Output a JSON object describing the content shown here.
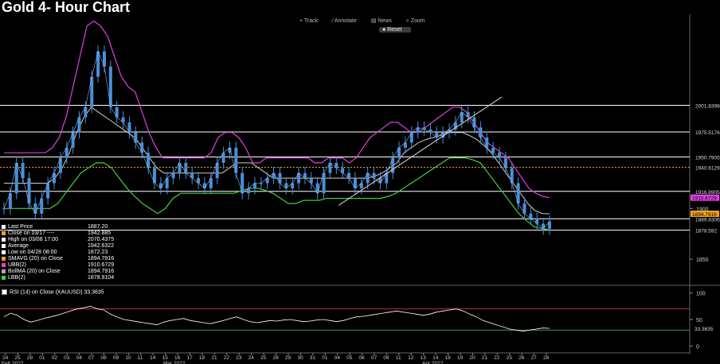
{
  "title": "Gold 4- Hour Chart",
  "toolbar": {
    "track": "Track",
    "annotate": "Annotate",
    "news": "News",
    "zoom": "Zoom",
    "reset": "Reset"
  },
  "legend": [
    {
      "label": "Last Price",
      "value": "1887.20",
      "color": "#ffffff"
    },
    {
      "label": "Close on 03/17 ----",
      "value": "1942.885",
      "color": "#f0a020"
    },
    {
      "label": "High on 03/08 17:00",
      "value": "2070.4375",
      "color": "#ffffff"
    },
    {
      "label": "Average",
      "value": "1942.6322",
      "color": "#ffffff"
    },
    {
      "label": "Low on 04/28 08:00",
      "value": "1872.23",
      "color": "#ffffff"
    },
    {
      "label": "SMAVG (20)  on Close",
      "value": "1894.7916",
      "color": "#f0a020"
    },
    {
      "label": "UBB(2)",
      "value": "1910.6729",
      "color": "#e040e0"
    },
    {
      "label": "BollMA (20)  on Close",
      "value": "1894.7916",
      "color": "#aaaaaa"
    },
    {
      "label": "LBB(2)",
      "value": "1878.9104",
      "color": "#40d040"
    }
  ],
  "rsi_label": "RSI (14)  on Close (XAUUSD) 33.3635",
  "colors": {
    "upper_band": "#e040e0",
    "lower_band": "#40d040",
    "mid_band": "#cccccc",
    "price": "#4a8fd8",
    "rsi": "#ffffff",
    "rsi_overbought": "#c03030"
  },
  "chart_data": [
    {
      "type": "line",
      "title": "Gold 4- Hour Chart",
      "xlabel": "",
      "ylabel": "",
      "x_ticks": [
        "24",
        "25",
        "28",
        "01",
        "02",
        "03",
        "04",
        "07",
        "08",
        "09",
        "10",
        "11",
        "14",
        "15",
        "16",
        "17",
        "18",
        "21",
        "22",
        "23",
        "24",
        "25",
        "28",
        "29",
        "30",
        "31",
        "01",
        "04",
        "05",
        "06",
        "07",
        "08",
        "11",
        "12",
        "13",
        "14",
        "18",
        "19",
        "20",
        "21",
        "22",
        "25",
        "26",
        "27",
        "28"
      ],
      "months": [
        "Feb 2022",
        "Mar 2022",
        "Apr 2022"
      ],
      "y_ticks": [
        1850,
        1900
      ],
      "ylim": [
        1825,
        2090
      ],
      "horizontal_levels": [
        {
          "label": "2001.8398",
          "value": 2001.8398
        },
        {
          "label": "1975.5176",
          "value": 1975.5176
        },
        {
          "label": "1950.7905",
          "value": 1950.7905
        },
        {
          "label": "1940.6129",
          "value": 1940.6129
        },
        {
          "label": "1916.8905",
          "value": 1916.8905
        },
        {
          "label": "1889.8306",
          "value": 1889.8306
        },
        {
          "label": "1878.592",
          "value": 1878.592
        }
      ],
      "right_labels": [
        {
          "label": "1910.6729",
          "value": 1910.6729,
          "color": "#e040e0"
        },
        {
          "label": "1894.7916",
          "value": 1894.7916,
          "color": "#f0a020"
        }
      ],
      "series": [
        {
          "name": "Last Price",
          "values": [
            1900,
            1915,
            1945,
            1930,
            1905,
            1895,
            1910,
            1925,
            1935,
            1950,
            1960,
            1975,
            1990,
            2000,
            2030,
            2055,
            2040,
            2000,
            1990,
            1985,
            1975,
            1965,
            1955,
            1940,
            1925,
            1920,
            1930,
            1935,
            1945,
            1935,
            1930,
            1925,
            1920,
            1930,
            1945,
            1955,
            1960,
            1935,
            1915,
            1920,
            1925,
            1925,
            1930,
            1935,
            1925,
            1920,
            1925,
            1935,
            1930,
            1925,
            1915,
            1935,
            1945,
            1940,
            1935,
            1930,
            1920,
            1925,
            1935,
            1930,
            1925,
            1935,
            1950,
            1960,
            1965,
            1975,
            1980,
            1978,
            1975,
            1970,
            1975,
            1978,
            1985,
            1995,
            1990,
            1980,
            1970,
            1960,
            1955,
            1950,
            1940,
            1925,
            1905,
            1895,
            1890,
            1885,
            1880,
            1887.2
          ]
        },
        {
          "name": "UBB(2)",
          "values": [
            1955,
            1955,
            1955,
            1955,
            1955,
            1955,
            1955,
            1960,
            1970,
            1990,
            2020,
            2050,
            2080,
            2085,
            2080,
            2070,
            2050,
            2030,
            2020,
            2015,
            1995,
            1975,
            1960,
            1950,
            1950,
            1950,
            1950,
            1950,
            1950,
            1950,
            1955,
            1970,
            1975,
            1975,
            1970,
            1960,
            1945,
            1945,
            1950,
            1950,
            1950,
            1950,
            1950,
            1950,
            1950,
            1945,
            1945,
            1950,
            1950,
            1950,
            1945,
            1950,
            1960,
            1970,
            1975,
            1980,
            1985,
            1985,
            1980,
            1975,
            1975,
            1980,
            1985,
            1990,
            1995,
            2000,
            2000,
            1995,
            1985,
            1975,
            1965,
            1960,
            1955,
            1950,
            1940,
            1930,
            1920,
            1915,
            1912,
            1910.67
          ]
        },
        {
          "name": "BollMA (20)",
          "values": [
            1925,
            1925,
            1925,
            1925,
            1925,
            1925,
            1925,
            1930,
            1940,
            1955,
            1975,
            1990,
            2000,
            1995,
            1990,
            1985,
            1980,
            1975,
            1970,
            1960,
            1950,
            1940,
            1935,
            1935,
            1935,
            1935,
            1935,
            1935,
            1935,
            1935,
            1935,
            1940,
            1945,
            1945,
            1945,
            1940,
            1935,
            1930,
            1930,
            1930,
            1930,
            1930,
            1930,
            1930,
            1930,
            1930,
            1930,
            1930,
            1930,
            1930,
            1930,
            1932,
            1935,
            1940,
            1945,
            1955,
            1960,
            1965,
            1968,
            1970,
            1972,
            1975,
            1975,
            1975,
            1972,
            1968,
            1962,
            1955,
            1945,
            1935,
            1925,
            1915,
            1905,
            1898,
            1895,
            1894.79
          ]
        },
        {
          "name": "LBB(2)",
          "values": [
            1900,
            1900,
            1900,
            1900,
            1900,
            1900,
            1900,
            1905,
            1915,
            1925,
            1935,
            1940,
            1945,
            1945,
            1940,
            1930,
            1920,
            1912,
            1905,
            1900,
            1895,
            1900,
            1910,
            1915,
            1915,
            1915,
            1915,
            1915,
            1915,
            1915,
            1915,
            1918,
            1920,
            1920,
            1918,
            1915,
            1910,
            1905,
            1905,
            1908,
            1908,
            1908,
            1910,
            1910,
            1910,
            1910,
            1910,
            1910,
            1910,
            1910,
            1912,
            1915,
            1920,
            1925,
            1930,
            1935,
            1940,
            1945,
            1950,
            1950,
            1950,
            1948,
            1945,
            1935,
            1925,
            1915,
            1905,
            1895,
            1888,
            1882,
            1880,
            1878.91
          ]
        }
      ]
    },
    {
      "type": "line",
      "title": "RSI (14)  on Close (XAUUSD) 33.3635",
      "y_ticks": [
        0,
        50,
        100
      ],
      "ylim": [
        -10,
        110
      ],
      "levels": [
        70,
        30
      ],
      "right_labels": [
        {
          "label": "33.3635",
          "value": 33.3635
        }
      ],
      "series": [
        {
          "name": "RSI (14)",
          "values": [
            55,
            62,
            58,
            50,
            45,
            48,
            52,
            55,
            58,
            62,
            66,
            70,
            72,
            75,
            70,
            68,
            60,
            55,
            50,
            48,
            46,
            44,
            42,
            40,
            45,
            48,
            50,
            52,
            48,
            46,
            44,
            42,
            45,
            48,
            52,
            55,
            50,
            46,
            44,
            46,
            48,
            47,
            49,
            50,
            48,
            46,
            47,
            49,
            50,
            48,
            46,
            48,
            52,
            55,
            56,
            58,
            60,
            62,
            64,
            66,
            64,
            62,
            60,
            58,
            60,
            64,
            66,
            68,
            70,
            66,
            60,
            55,
            48,
            44,
            40,
            36,
            32,
            30,
            28,
            30,
            32,
            34,
            33.3635
          ]
        }
      ]
    }
  ]
}
